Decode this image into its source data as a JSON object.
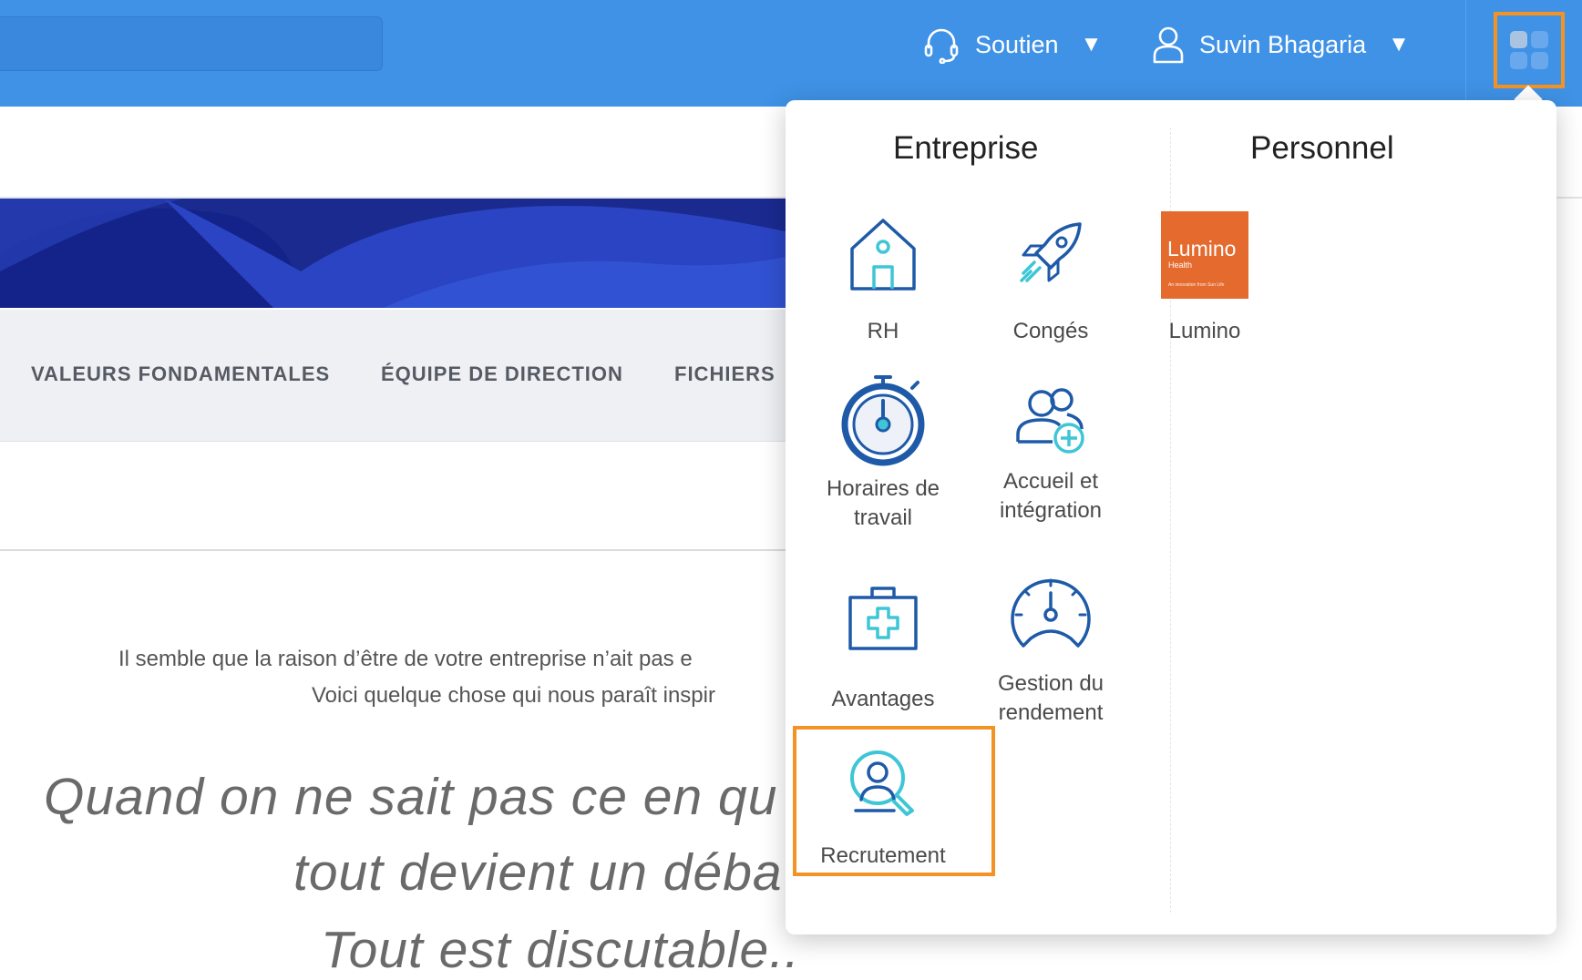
{
  "colors": {
    "header_blue": "#3f92e6",
    "highlight_orange": "#f39325",
    "banner_navy": "#1c2f9b",
    "lumino_orange": "#e56a2e",
    "icon_navy": "#1e5aa8",
    "icon_teal": "#3ec6d6"
  },
  "header": {
    "support_label": "Soutien",
    "support_caret": "▼",
    "user_name": "Suvin Bhagaria",
    "user_caret": "▼"
  },
  "page": {
    "tabs": [
      "VALEURS FONDAMENTALES",
      "ÉQUIPE DE DIRECTION",
      "FICHIERS"
    ],
    "message_line1": "Il semble que la raison d’être de votre entreprise n’ait pas e",
    "message_line2": "Voici quelque chose qui nous paraît inspir",
    "quote_line1": "Quand on ne sait pas ce en qu",
    "quote_line2": "tout devient un déba",
    "quote_line3": "Tout est discutable.."
  },
  "apps_menu": {
    "company_title": "Entreprise",
    "personal_title": "Personnel",
    "company_apps": [
      {
        "label": "RH",
        "icon": "house-icon"
      },
      {
        "label": "Congés",
        "icon": "rocket-icon"
      },
      {
        "label": "Horaires de travail",
        "icon": "stopwatch-icon"
      },
      {
        "label": "Accueil et intégration",
        "icon": "add-people-icon"
      },
      {
        "label": "Avantages",
        "icon": "medical-kit-icon"
      },
      {
        "label": "Gestion du rendement",
        "icon": "speedometer-icon"
      },
      {
        "label": "Recrutement",
        "icon": "candidate-search-icon"
      }
    ],
    "personal_apps": [
      {
        "label": "Lumino",
        "icon": "lumino-logo"
      }
    ],
    "lumino_logo": {
      "wordmark": "Lumino",
      "sub": "Health",
      "tagline": "An innovation from Sun Life"
    }
  }
}
